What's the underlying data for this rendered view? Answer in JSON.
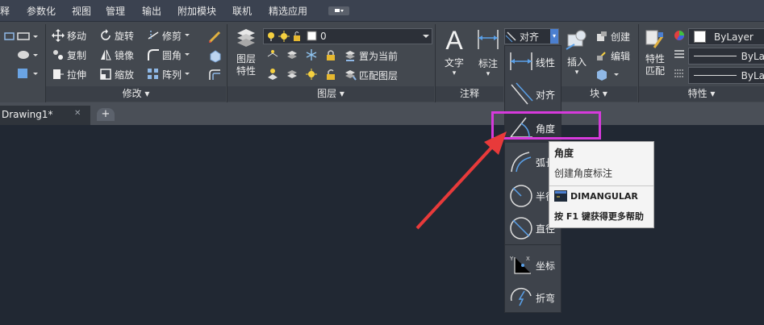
{
  "menubar": {
    "items": [
      "释",
      "参数化",
      "视图",
      "管理",
      "输出",
      "附加模块",
      "联机",
      "精选应用"
    ]
  },
  "modify": {
    "title": "修改",
    "tools": [
      "移动",
      "旋转",
      "修剪",
      "复制",
      "镜像",
      "圆角",
      "拉伸",
      "缩放",
      "阵列"
    ]
  },
  "layers": {
    "title": "图层",
    "big_label_line1": "图层",
    "big_label_line2": "特性",
    "current_layer": "0",
    "set_current": "置为当前",
    "match_layer": "匹配图层"
  },
  "annotation": {
    "title": "注释",
    "text_label": "文字",
    "dim_label": "标注",
    "dim_style": "对齐",
    "text_glyph": "A"
  },
  "block": {
    "title": "块",
    "insert": "插入",
    "create": "创建",
    "edit": "编辑"
  },
  "properties": {
    "title": "特性",
    "match_line1": "特性",
    "match_line2": "匹配",
    "color": "ByLayer",
    "linetype": "ByLa",
    "lineweight": "ByLa"
  },
  "tabs": {
    "document": "Drawing1*",
    "add_glyph": "+",
    "close_glyph": "✕"
  },
  "dropdown": {
    "items": [
      "线性",
      "对齐",
      "角度",
      "弧长",
      "半径",
      "直径",
      "坐标",
      "折弯"
    ]
  },
  "tooltip": {
    "title": "角度",
    "description": "创建角度标注",
    "command": "DIMANGULAR",
    "help": "按 F1 键获得更多帮助"
  },
  "colors": {
    "highlight_box": "#d63adc",
    "arrow": "#e83a3a",
    "accent_blue": "#5aa0e8"
  }
}
